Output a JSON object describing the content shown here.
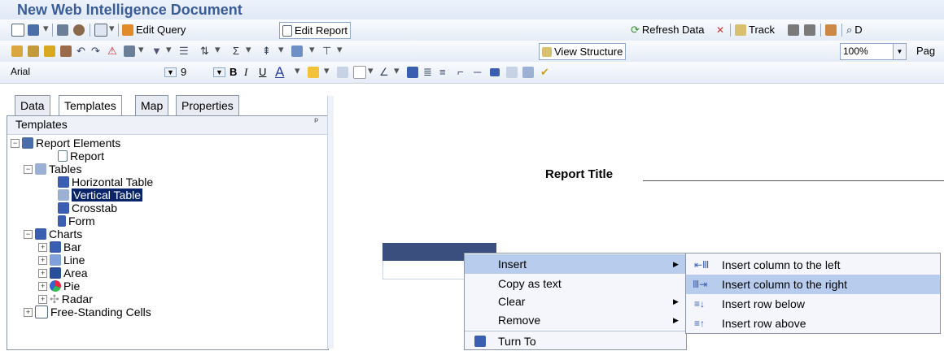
{
  "window": {
    "title": "New Web Intelligence Document"
  },
  "toolbar1": {
    "edit_query": "Edit Query",
    "edit_report": "Edit Report",
    "refresh_data": "Refresh Data",
    "track": "Track",
    "d_label": "D"
  },
  "toolbar2": {
    "view_structure": "View Structure",
    "zoom": "100%",
    "page_label": "Pag"
  },
  "toolbar3": {
    "font_name": "Arial",
    "font_size": "9",
    "bold": "B",
    "italic": "I",
    "underline": "U",
    "font_color": "A"
  },
  "tabs": [
    "Data",
    "Templates",
    "Map",
    "Properties"
  ],
  "panel": {
    "title": "Templates",
    "pin": "ᵖ"
  },
  "tree": {
    "report_elements": "Report Elements",
    "report": "Report",
    "tables": "Tables",
    "horizontal_table": "Horizontal Table",
    "vertical_table": "Vertical Table",
    "crosstab": "Crosstab",
    "form": "Form",
    "charts": "Charts",
    "bar": "Bar",
    "line": "Line",
    "area": "Area",
    "pie": "Pie",
    "radar": "Radar",
    "free_standing": "Free-Standing Cells"
  },
  "report": {
    "title": "Report Title"
  },
  "context_menu": {
    "insert": "Insert",
    "copy_as_text": "Copy as text",
    "clear": "Clear",
    "remove": "Remove",
    "turn_to": "Turn To"
  },
  "submenu": {
    "col_left": "Insert column to the left",
    "col_right": "Insert column to the right",
    "row_below": "Insert row below",
    "row_above": "Insert row above"
  },
  "colors": {
    "selection": "#0a246a",
    "highlight": "#b8cdee",
    "title": "#3a5d9a",
    "table_header": "#3a4f7e"
  }
}
